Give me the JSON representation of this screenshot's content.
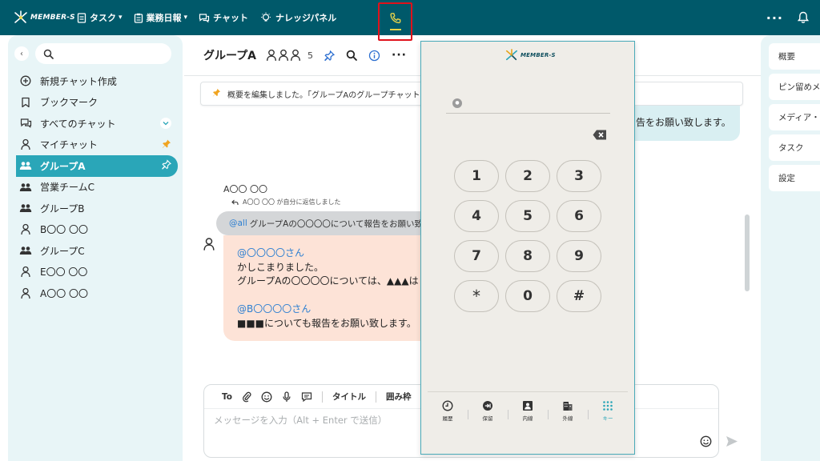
{
  "app": {
    "logo_text": "MEMBER-S",
    "nav": [
      {
        "label": "タスク",
        "icon": "document-icon",
        "has_dropdown": true
      },
      {
        "label": "業務日報",
        "icon": "clipboard-icon",
        "has_dropdown": true
      },
      {
        "label": "チャット",
        "icon": "chat-bubbles-icon",
        "has_dropdown": false
      },
      {
        "label": "ナレッジパネル",
        "icon": "lightbulb-icon",
        "has_dropdown": false
      }
    ],
    "phone_icon": "phone-icon",
    "more_icon": "ellipsis-icon",
    "bell_icon": "bell-icon",
    "accent_color": "#00596a",
    "highlight_color": "#e0121b"
  },
  "sidebar": {
    "search_placeholder": "",
    "items": [
      {
        "label": "新規チャット作成",
        "icon": "plus-circle-icon",
        "active": false
      },
      {
        "label": "ブックマーク",
        "icon": "bookmark-icon",
        "active": false
      },
      {
        "label": "すべてのチャット",
        "icon": "chat-bubbles-icon",
        "active": false
      },
      {
        "label": "マイチャット",
        "icon": "person-icon",
        "active": false
      },
      {
        "label": "グループA",
        "icon": "group-icon",
        "active": true
      },
      {
        "label": "営業チームC",
        "icon": "group-icon",
        "active": false
      },
      {
        "label": "グループB",
        "icon": "group-icon",
        "active": false
      },
      {
        "label": "B〇〇 〇〇",
        "icon": "person-icon",
        "active": false
      },
      {
        "label": "グループC",
        "icon": "group-icon",
        "active": false
      },
      {
        "label": "E〇〇 〇〇",
        "icon": "person-icon",
        "active": false
      },
      {
        "label": "A〇〇 〇〇",
        "icon": "person-icon",
        "active": false
      }
    ]
  },
  "chat": {
    "title": "グループA",
    "member_count": "5",
    "notice": "概要を編集しました。「グループAのグループチャット",
    "right_bubble_text": "告をお願い致します。",
    "sender_name": "A〇〇 〇〇",
    "reply_note": "A〇〇 〇〇 が自分に返信しました",
    "quote_mention": "@all",
    "quote_text": "グループAの〇〇〇〇について報告をお願い致",
    "message_lines": [
      {
        "text": "@〇〇〇〇さん",
        "mention": true
      },
      {
        "text": "かしこまりました。",
        "mention": false
      },
      {
        "text": "グループAの〇〇〇〇については、▲▲▲は",
        "mention": false
      },
      {
        "text": "",
        "mention": false
      },
      {
        "text": "@B〇〇〇〇さん",
        "mention": true
      },
      {
        "text": "■■■についても報告をお願い致します。",
        "mention": false
      }
    ]
  },
  "composer": {
    "tools": {
      "to": "To",
      "heading": "タイトル",
      "frame": "囲み枠"
    },
    "placeholder": "メッセージを入力（Alt + Enter で送信）"
  },
  "rightbar": {
    "items": [
      "概要",
      "ピン留めメ",
      "メディア・",
      "タスク",
      "設定"
    ]
  },
  "dialer": {
    "logo_text": "MEMBER-S",
    "keys": [
      "1",
      "2",
      "3",
      "4",
      "5",
      "6",
      "7",
      "8",
      "9",
      "*",
      "0",
      "#"
    ],
    "tabs": [
      {
        "label": "履歴",
        "icon": "clock-icon",
        "active": false
      },
      {
        "label": "保留",
        "icon": "hold-icon",
        "active": false
      },
      {
        "label": "内線",
        "icon": "contact-card-icon",
        "active": false
      },
      {
        "label": "外線",
        "icon": "building-icon",
        "active": false
      },
      {
        "label": "キー",
        "icon": "keypad-icon",
        "active": true
      }
    ],
    "active_tab_color": "#2aa6b8"
  }
}
